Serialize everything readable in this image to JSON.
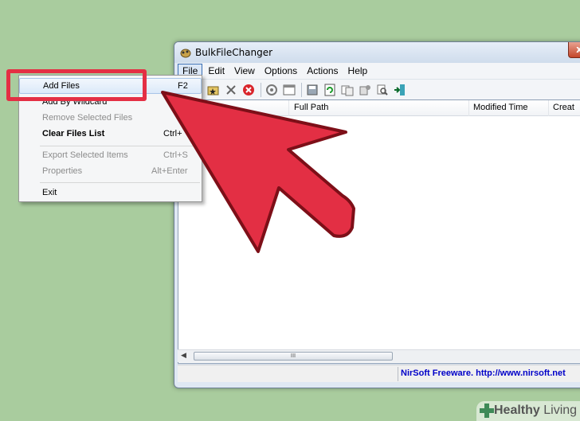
{
  "window": {
    "title": "BulkFileChanger",
    "close_glyph": "x"
  },
  "menubar": {
    "items": [
      {
        "label": "File"
      },
      {
        "label": "Edit"
      },
      {
        "label": "View"
      },
      {
        "label": "Options"
      },
      {
        "label": "Actions"
      },
      {
        "label": "Help"
      }
    ]
  },
  "toolbar": {
    "icons": [
      "add-files-icon",
      "delete-icon",
      "stop-icon",
      "properties-icon",
      "window-icon",
      "save-icon",
      "refresh-icon",
      "copy-icon",
      "settings-icon",
      "search-icon",
      "exit-icon"
    ]
  },
  "list": {
    "columns": [
      "Full Path",
      "Modified Time",
      "Creat"
    ]
  },
  "scrollbar": {
    "thumb_glyph": "III"
  },
  "status": {
    "link_text": "NirSoft Freeware.  http://www.nirsoft.net"
  },
  "file_menu": {
    "items": [
      {
        "label": "Add Files",
        "shortcut": "F2",
        "state": "highlight"
      },
      {
        "label": "Add By Wildcard",
        "shortcut": "",
        "state": "normal"
      },
      {
        "label": "Remove Selected Files",
        "shortcut": "",
        "state": "disabled"
      },
      {
        "label": "Clear Files List",
        "shortcut": "Ctrl+",
        "state": "bold"
      },
      {
        "label": "Export Selected Items",
        "shortcut": "Ctrl+S",
        "state": "disabled"
      },
      {
        "label": "Properties",
        "shortcut": "Alt+Enter",
        "state": "disabled"
      },
      {
        "label": "Exit",
        "shortcut": "",
        "state": "normal"
      }
    ]
  },
  "annotation": {
    "highlight_color": "#e42f44",
    "arrow_color": "#e32f44"
  },
  "watermark": {
    "bold": "Healthy",
    "thin": " Living"
  }
}
